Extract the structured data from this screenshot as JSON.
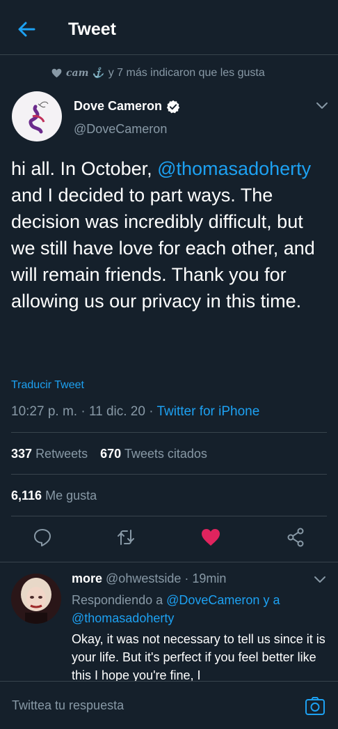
{
  "header": {
    "title": "Tweet"
  },
  "social_context": {
    "liker": "cam ⚓",
    "text": "y 7 más indicaron que les gusta"
  },
  "tweet": {
    "author_name": "Dove Cameron",
    "handle": "@DoveCameron",
    "text_before": "hi all. In October, ",
    "mention": "@thomasadoherty",
    "text_after": " and I decided to part ways. The decision was incredibly difficult, but we still have love for each other, and will remain friends. Thank you for allowing us our privacy in this time.",
    "translate_label": "Traducir Tweet",
    "timestamp": "10:27 p. m. · 11 dic. 20 · ",
    "source": "Twitter for iPhone"
  },
  "stats": {
    "retweets_count": "337",
    "retweets_label": "Retweets",
    "quotes_count": "670",
    "quotes_label": "Tweets citados",
    "likes_count": "6,116",
    "likes_label": "Me gusta"
  },
  "reply": {
    "name": "more",
    "handle": "@ohwestside · 19min",
    "replying_prefix": "Respondiendo a ",
    "replying_mention1": "@DoveCameron",
    "replying_mid": " y a",
    "replying_mention2": "@thomasadoherty",
    "text": "Okay, it was not necessary to tell us since it is your life. But it's perfect if you feel better like this I hope you're fine, I"
  },
  "compose": {
    "placeholder": "Twittea tu respuesta"
  },
  "colors": {
    "background": "#15202b",
    "accent": "#1da1f2",
    "secondary_text": "#8899a6",
    "like": "#e0245e",
    "divider": "#38444d"
  },
  "icons": [
    "back-arrow-icon",
    "heart-icon",
    "verified-badge-icon",
    "chevron-down-icon",
    "reply-icon",
    "retweet-icon",
    "like-icon",
    "share-icon",
    "camera-icon"
  ]
}
